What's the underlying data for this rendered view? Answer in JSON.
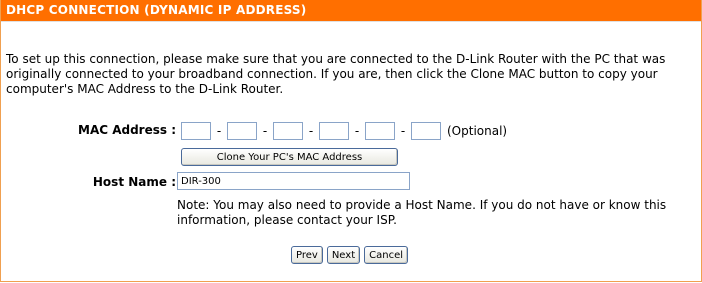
{
  "section": {
    "title": "DHCP CONNECTION (DYNAMIC IP ADDRESS)"
  },
  "intro_text": "To set up this connection, please make sure that you are connected to the D-Link Router with the PC that was originally connected to your broadband connection. If you are, then click the Clone MAC button to copy your computer's MAC Address to the D-Link Router.",
  "mac": {
    "label": "MAC Address :",
    "fields": [
      "",
      "",
      "",
      "",
      "",
      ""
    ],
    "separator": "-",
    "optional_text": "(Optional)",
    "clone_button": "Clone Your PC's MAC Address"
  },
  "host": {
    "label": "Host Name :",
    "value": "DIR-300"
  },
  "note": "Note: You may also need to provide a Host Name. If you do not have or know this information, please contact your ISP.",
  "buttons": {
    "prev": "Prev",
    "next": "Next",
    "cancel": "Cancel"
  },
  "colors": {
    "header_bg": "#ff6f00",
    "header_text": "#ffffff"
  }
}
